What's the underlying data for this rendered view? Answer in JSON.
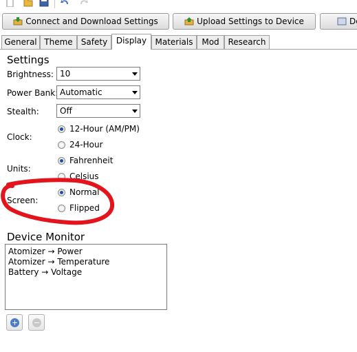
{
  "toolbar": {
    "connect_label": "Connect and Download Settings",
    "upload_label": "Upload Settings to Device",
    "third_label": "De",
    "icons": [
      "new-file-icon",
      "open-folder-icon",
      "save-icon",
      "undo-icon",
      "redo-icon"
    ]
  },
  "tabs": [
    {
      "label": "General"
    },
    {
      "label": "Theme"
    },
    {
      "label": "Safety"
    },
    {
      "label": "Display",
      "active": true
    },
    {
      "label": "Materials"
    },
    {
      "label": "Mod"
    },
    {
      "label": "Research"
    }
  ],
  "settings": {
    "heading": "Settings",
    "brightness": {
      "label": "Brightness:",
      "value": "10"
    },
    "power_bank": {
      "label": "Power Bank:",
      "value": "Automatic"
    },
    "stealth": {
      "label": "Stealth:",
      "value": "Off"
    },
    "clock": {
      "label": "Clock:",
      "options": [
        "12-Hour (AM/PM)",
        "24-Hour"
      ],
      "selected": "12-Hour (AM/PM)"
    },
    "units": {
      "label": "Units:",
      "options": [
        "Fahrenheit",
        "Celsius"
      ],
      "selected": "Fahrenheit"
    },
    "screen": {
      "label": "Screen:",
      "options": [
        "Normal",
        "Flipped"
      ],
      "selected": "Normal"
    }
  },
  "device_monitor": {
    "heading": "Device Monitor",
    "items": [
      "Atomizer → Power",
      "Atomizer → Temperature",
      "Battery → Voltage"
    ]
  },
  "colors": {
    "annotation": "#e3141c",
    "radio_dot": "#1d4fa0",
    "tab_border": "#a0a0a0"
  }
}
